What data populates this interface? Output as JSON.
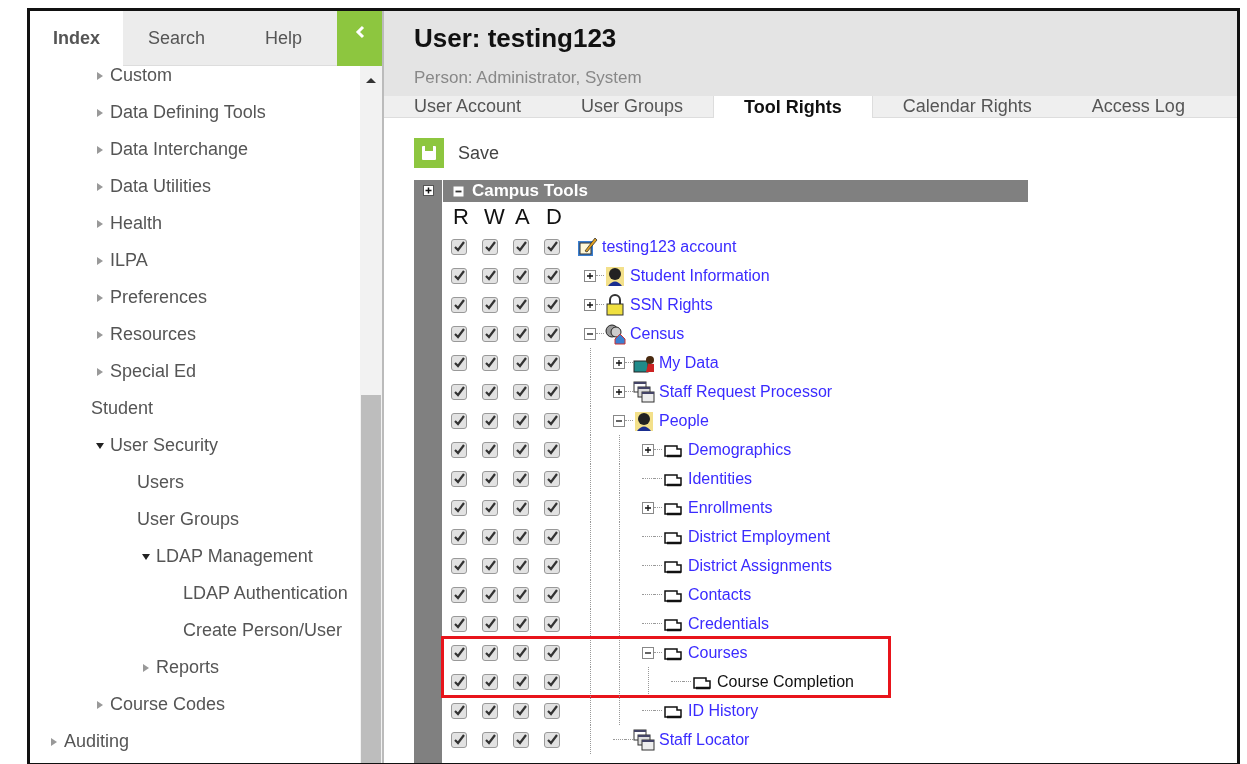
{
  "sidebar": {
    "tabs": [
      {
        "label": "Index",
        "selected": true
      },
      {
        "label": "Search",
        "selected": false
      },
      {
        "label": "Help",
        "selected": false
      }
    ],
    "items": [
      {
        "children": [
          {
            "label": "Custom",
            "expanded": false
          },
          {
            "label": "Data Defining Tools",
            "expanded": false
          },
          {
            "label": "Data Interchange",
            "expanded": false
          },
          {
            "label": "Data Utilities",
            "expanded": false
          },
          {
            "label": "Health",
            "expanded": false
          },
          {
            "label": "ILPA",
            "expanded": false
          },
          {
            "label": "Preferences",
            "expanded": false
          },
          {
            "label": "Resources",
            "expanded": false
          },
          {
            "label": "Special Ed",
            "expanded": false
          },
          {
            "label": "Student"
          },
          {
            "label": "User Security",
            "expanded": true,
            "children": [
              {
                "label": "Users"
              },
              {
                "label": "User Groups"
              },
              {
                "label": "LDAP Management",
                "expanded": true,
                "children": [
                  {
                    "label": "LDAP Authentication"
                  },
                  {
                    "label": "Create Person/User"
                  }
                ]
              },
              {
                "label": "Reports",
                "expanded": false
              }
            ]
          },
          {
            "label": "Course Codes",
            "expanded": false
          }
        ]
      },
      {
        "label": "Auditing",
        "expanded": false
      }
    ]
  },
  "title": "User: testing123",
  "subtitle": "Person: Administrator, System",
  "tabs": [
    {
      "label": "User Account",
      "selected": false
    },
    {
      "label": "User Groups",
      "selected": false
    },
    {
      "label": "Tool Rights",
      "selected": true
    },
    {
      "label": "Calendar Rights",
      "selected": false
    },
    {
      "label": "Access Log",
      "selected": false
    }
  ],
  "save_button": "Save",
  "section": {
    "title": "Campus Tools",
    "expanded": true
  },
  "columns": [
    "R",
    "W",
    "A",
    "D"
  ],
  "tree": [
    {
      "label": "testing123 account",
      "kind": "account",
      "rights": [
        true,
        true,
        true,
        true
      ],
      "children": [
        {
          "label": "Student Information",
          "kind": "person",
          "expanded": false,
          "rights": [
            true,
            true,
            true,
            true
          ]
        },
        {
          "label": "SSN Rights",
          "kind": "lock",
          "expanded": false,
          "rights": [
            true,
            true,
            true,
            true
          ]
        },
        {
          "label": "Census",
          "kind": "census",
          "expanded": true,
          "rights": [
            true,
            true,
            true,
            true
          ],
          "children": [
            {
              "label": "My Data",
              "kind": "briefcase",
              "expanded": false,
              "rights": [
                true,
                true,
                true,
                true
              ]
            },
            {
              "label": "Staff Request Processor",
              "kind": "windows",
              "expanded": false,
              "rights": [
                true,
                true,
                true,
                true
              ]
            },
            {
              "label": "People",
              "kind": "person",
              "expanded": true,
              "rights": [
                true,
                true,
                true,
                true
              ],
              "children": [
                {
                  "label": "Demographics",
                  "kind": "folder",
                  "expanded": false,
                  "rights": [
                    true,
                    true,
                    true,
                    true
                  ]
                },
                {
                  "label": "Identities",
                  "kind": "folder",
                  "rights": [
                    true,
                    true,
                    true,
                    true
                  ]
                },
                {
                  "label": "Enrollments",
                  "kind": "folder",
                  "expanded": false,
                  "rights": [
                    true,
                    true,
                    true,
                    true
                  ]
                },
                {
                  "label": "District Employment",
                  "kind": "folder",
                  "rights": [
                    true,
                    true,
                    true,
                    true
                  ]
                },
                {
                  "label": "District Assignments",
                  "kind": "folder",
                  "rights": [
                    true,
                    true,
                    true,
                    true
                  ]
                },
                {
                  "label": "Contacts",
                  "kind": "folder",
                  "rights": [
                    true,
                    true,
                    true,
                    true
                  ]
                },
                {
                  "label": "Credentials",
                  "kind": "folder",
                  "rights": [
                    true,
                    true,
                    true,
                    true
                  ]
                },
                {
                  "label": "Courses",
                  "kind": "folder",
                  "expanded": true,
                  "highlighted": true,
                  "rights": [
                    true,
                    true,
                    true,
                    true
                  ],
                  "children": [
                    {
                      "label": "Course Completion",
                      "kind": "folder",
                      "highlighted": true,
                      "link": false,
                      "rights": [
                        true,
                        true,
                        true,
                        true
                      ]
                    }
                  ]
                },
                {
                  "label": "ID History",
                  "kind": "folder",
                  "rights": [
                    true,
                    true,
                    true,
                    true
                  ]
                }
              ]
            },
            {
              "label": "Staff Locator",
              "kind": "windows",
              "rights": [
                true,
                true,
                true,
                true
              ]
            }
          ]
        }
      ]
    }
  ]
}
